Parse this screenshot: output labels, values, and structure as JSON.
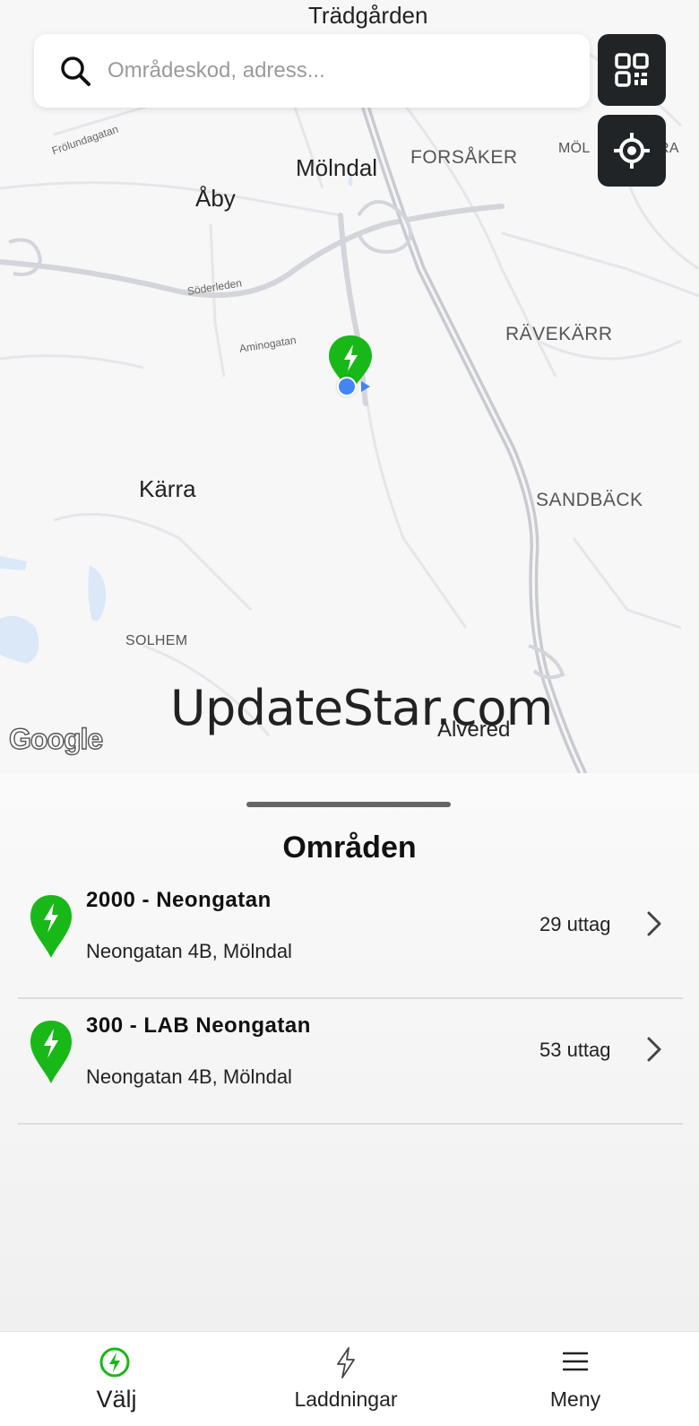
{
  "map": {
    "labels": {
      "tradgarden": "Trädgården",
      "molndal": "Mölndal",
      "forsaker": "FORSÅKER",
      "molnlycke": "MÖL",
      "molnlycke_suffix": "RA",
      "aby": "Åby",
      "frolundagatan": "Frölundagatan",
      "soderleden": "Söderleden",
      "aminogatan": "Aminogatan",
      "ravekarr": "RÄVEKÄRR",
      "karra": "Kärra",
      "sandback": "SANDBÄCK",
      "solhem": "SOLHEM",
      "alvered": "Alvered"
    },
    "watermark": "UpdateStar.com",
    "attribution": "Google"
  },
  "search": {
    "placeholder": "Områdeskod, adress...",
    "value": ""
  },
  "controls": {
    "qr_icon": "qr-code-icon",
    "locate_icon": "crosshair-icon"
  },
  "sheet": {
    "title": "Områden",
    "areas": [
      {
        "name": "2000 - Neongatan",
        "address": "Neongatan 4B, Mölndal",
        "outlets": "29 uttag"
      },
      {
        "name": "300 - LAB Neongatan",
        "address": "Neongatan 4B, Mölndal",
        "outlets": "53 uttag"
      }
    ]
  },
  "tabs": [
    {
      "label": "Välj",
      "icon": "lightning-circle-icon",
      "active": true
    },
    {
      "label": "Laddningar",
      "icon": "lightning-icon",
      "active": false
    },
    {
      "label": "Meny",
      "icon": "hamburger-menu-icon",
      "active": false
    }
  ],
  "colors": {
    "accent_green": "#18b818",
    "dark_button": "#202427",
    "user_location_blue": "#4285f4"
  }
}
